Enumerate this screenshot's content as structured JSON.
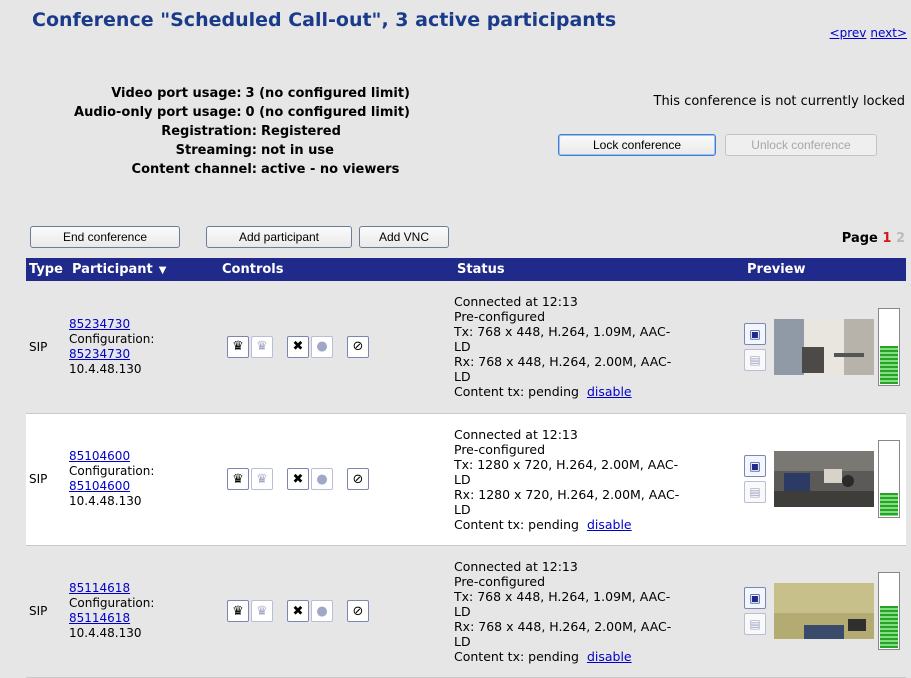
{
  "header": {
    "title": "Conference \"Scheduled Call-out\", 3 active participants",
    "prev": "<prev",
    "next": "next>"
  },
  "info": [
    {
      "label": "Video port usage:",
      "value": "3 (no configured limit)"
    },
    {
      "label": "Audio-only port usage:",
      "value": "0 (no configured limit)"
    },
    {
      "label": "Registration:",
      "value": "Registered"
    },
    {
      "label": "Streaming:",
      "value": "not in use"
    },
    {
      "label": "Content channel:",
      "value": "active - no viewers"
    }
  ],
  "lock": {
    "status": "This conference is not currently locked",
    "lock_label": "Lock conference",
    "unlock_label": "Unlock conference"
  },
  "actions": {
    "end": "End conference",
    "add_participant": "Add participant",
    "add_vnc": "Add VNC"
  },
  "paging": {
    "label": "Page",
    "current": "1",
    "next": "2"
  },
  "table": {
    "headers": {
      "type": "Type",
      "participant": "Participant",
      "controls": "Controls",
      "status": "Status",
      "preview": "Preview"
    },
    "rows": [
      {
        "type": "SIP",
        "name": "85234730",
        "config_label": "Configuration:",
        "config": "85234730",
        "ip": "10.4.48.130",
        "status": [
          "Connected at 12:13",
          "Pre-configured",
          "Tx: 768 x 448, H.264, 1.09M, AAC-",
          "LD",
          "Rx: 768 x 448, H.264, 2.00M, AAC-",
          "LD"
        ],
        "content": "Content tx: pending",
        "disable": "disable",
        "level": 0.5
      },
      {
        "type": "SIP",
        "name": "85104600",
        "config_label": "Configuration:",
        "config": "85104600",
        "ip": "10.4.48.130",
        "status": [
          "Connected at 12:13",
          "Pre-configured",
          "Tx: 1280 x 720, H.264, 2.00M, AAC-",
          "LD",
          "Rx: 1280 x 720, H.264, 2.00M, AAC-",
          "LD"
        ],
        "content": "Content tx: pending",
        "disable": "disable",
        "level": 0.3
      },
      {
        "type": "SIP",
        "name": "85114618",
        "config_label": "Configuration:",
        "config": "85114618",
        "ip": "10.4.48.130",
        "status": [
          "Connected at 12:13",
          "Pre-configured",
          "Tx: 768 x 448, H.264, 1.09M, AAC-",
          "LD",
          "Rx: 768 x 448, H.264, 2.00M, AAC-",
          "LD"
        ],
        "content": "Content tx: pending",
        "disable": "disable",
        "level": 0.55
      }
    ]
  },
  "colors": {
    "title": "#1a3a8a",
    "header_bg": "#1f2a8a",
    "link": "#0000cc",
    "page_current": "#d61818",
    "meter": "#2aa02a"
  }
}
